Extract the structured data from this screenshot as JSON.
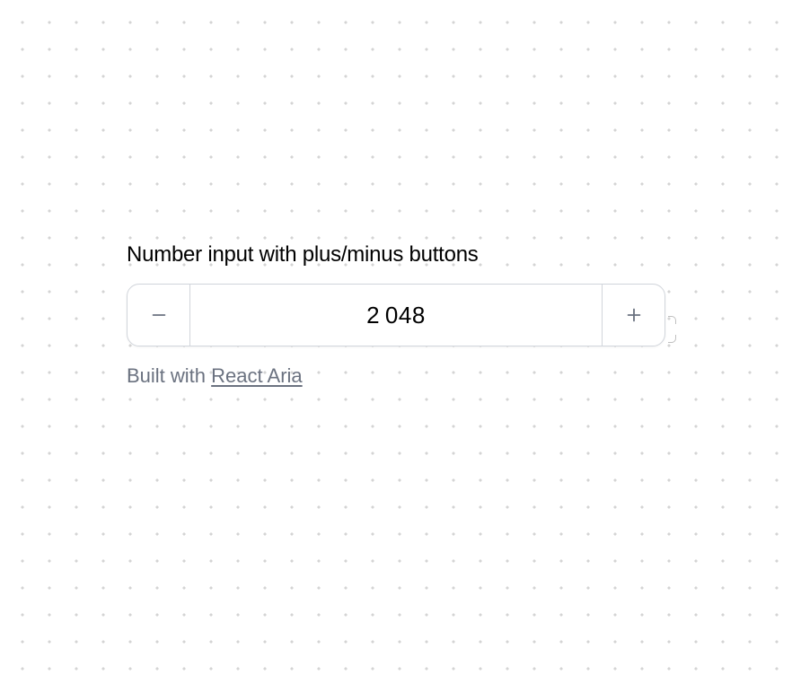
{
  "label": "Number input with plus/minus buttons",
  "value": "2 048",
  "decrement_icon": "minus-icon",
  "increment_icon": "plus-icon",
  "footer": {
    "prefix": "Built with ",
    "link_text": "React Aria"
  }
}
